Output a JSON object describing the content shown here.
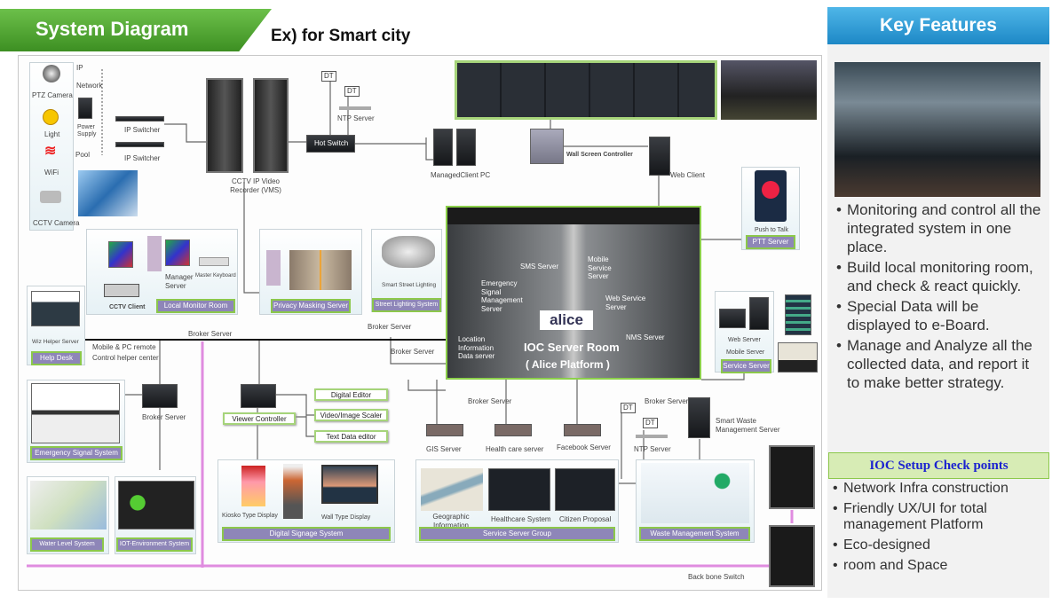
{
  "header": {
    "title": "System Diagram",
    "subtitle": "Ex) for Smart city",
    "accent": "#4aa02c"
  },
  "devices": {
    "ptz": "PTZ Camera",
    "light": "Light",
    "wifi": "WiFi",
    "cctv": "CCTV Camera",
    "ip": "IP",
    "network": "Network",
    "power": "Power Supply",
    "pool": "Pool",
    "ip_switcher_1": "IP Switcher",
    "ip_switcher_2": "IP Switcher",
    "vms": "CCTV IP Video Recorder (VMS)",
    "hot_switch": "Hot Switch",
    "dt": "DT",
    "ntp": "NTP Server",
    "managed_pc": "ManagedClient PC",
    "wall_ctrl": "Wall Screen Controller",
    "web_client": "Web Client",
    "push_to_talk": "Push to Talk",
    "ptt": "PTT Server"
  },
  "local_monitor": {
    "cctv_client": "CCTV Client",
    "manager": "Manager Server",
    "keyboard": "Master Keyboard",
    "title": "Local Monitor Room"
  },
  "privacy": {
    "title": "Privacy Masking Server"
  },
  "street": {
    "device": "Smart Street Lighting",
    "title": "Street Lighting System"
  },
  "helpdesk": {
    "server": "Wiz Helper Server",
    "title": "Help Desk",
    "remote": "Mobile & PC remote",
    "remote2": "Control helper center"
  },
  "broker": "Broker Server",
  "ioc": {
    "sms": "SMS Server",
    "mobile": "Mobile Service Server",
    "emergency": "Emergency Signal Management Server",
    "web": "Web Service Server",
    "location": "Location Information Data server",
    "nms": "NMS Server",
    "logo": "alice",
    "title": "IOC Server Room",
    "platform": "( Alice Platform )"
  },
  "service_server": {
    "web": "Web Server",
    "mobile": "Mobile Server",
    "title": "Service Server"
  },
  "emergency": {
    "title": "Emergency Signal System"
  },
  "water": {
    "title": "Water Level System"
  },
  "iot": {
    "title": "IOT-Environment System"
  },
  "viewer": {
    "controller": "Viewer Controller",
    "editor": "Digital Editor",
    "scaler": "Video/Image Scaler",
    "text": "Text Data editor"
  },
  "signage": {
    "kiosk": "Kiosko Type Display",
    "wall": "Wall Type Display",
    "title": "Digital Signage System"
  },
  "service_group": {
    "gis_server": "GIS Server",
    "health_server": "Health care server",
    "facebook": "Facebook  Server",
    "gis": "Geographic Information System",
    "health": "Healthcare System",
    "citizen": "Citizen Proposal",
    "title": "Service Server Group"
  },
  "waste": {
    "server": "Smart Waste Management Server",
    "title": "Waste Management System"
  },
  "backbone": "Back bone Switch",
  "key_features": {
    "title": "Key Features",
    "bullets": [
      "Monitoring and control all the integrated system in one place.",
      "Build local monitoring room, and check & react quickly.",
      "Special Data will be displayed to e-Board.",
      "Manage and Analyze all the collected data, and report it to make better strategy."
    ],
    "check_title": "IOC Setup Check points",
    "checks": [
      "Network Infra construction",
      "Friendly UX/UI for total management Platform",
      "Eco-designed",
      "room and Space"
    ]
  }
}
